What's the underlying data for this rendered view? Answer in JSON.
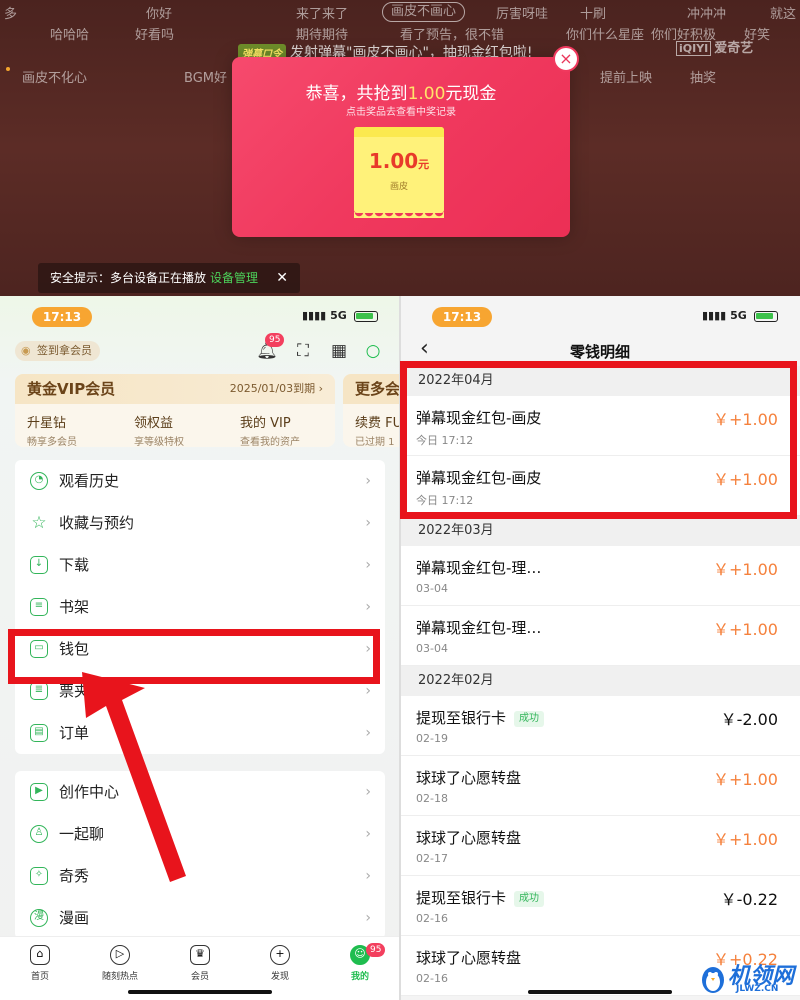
{
  "player": {
    "danmaku": [
      "多",
      "你好",
      "来了来了",
      "画皮不画心",
      "厉害呀哇",
      "十刷",
      "冲冲冲",
      "就这",
      "哈哈哈",
      "好看吗",
      "期待期待",
      "看了预告，很不错",
      "你们什么星座",
      "你们好积极",
      "好笑",
      "画皮不化心",
      "BGM好",
      "提前上映",
      "抽奖"
    ],
    "command_tag": "弹幕口令",
    "command_text": "发射弹幕\"画皮不画心\"，抽现金红包啦!",
    "brand": "爱奇艺",
    "brand_box": "iQIYI",
    "popup": {
      "title_prefix": "恭喜，共抢到",
      "title_amount": "1.00",
      "title_suffix": "元现金",
      "subtitle": "点击奖品去查看中奖记录",
      "ticket_value": "1.00",
      "ticket_unit": "元",
      "ticket_label": "画皮",
      "close": "×"
    },
    "safety": {
      "text": "安全提示：多台设备正在播放",
      "link": "设备管理",
      "close": "✕"
    }
  },
  "my_page": {
    "time": "17:13",
    "network": "5G",
    "sign_badge": "签到拿会员",
    "bell_badge": "95",
    "vip": {
      "title": "黄金VIP会员",
      "expiry": "2025/01/03到期 ›",
      "cols": [
        {
          "t": "升星钻",
          "s": "畅享多会员"
        },
        {
          "t": "领权益",
          "s": "享等级特权"
        },
        {
          "t": "我的 VIP",
          "s": "查看我的资产"
        }
      ]
    },
    "vip2": {
      "title": "更多会",
      "cols": [
        {
          "t": "续费 FU",
          "s": "已过期 1"
        }
      ]
    },
    "menu_group1": [
      "观看历史",
      "收藏与预约",
      "下载",
      "书架",
      "钱包",
      "票夹",
      "订单"
    ],
    "menu_group2": [
      "创作中心",
      "一起聊",
      "奇秀",
      "漫画"
    ],
    "tabs": [
      "首页",
      "随刻热点",
      "会员",
      "发现",
      "我的"
    ],
    "tab_badge": "95"
  },
  "detail_page": {
    "time": "17:13",
    "network": "5G",
    "title": "零钱明细",
    "sections": [
      {
        "month": "2022年04月",
        "rows": [
          {
            "name": "弹幕现金红包-画皮",
            "date": "今日 17:12",
            "amount": "￥+1.00",
            "status": ""
          },
          {
            "name": "弹幕现金红包-画皮",
            "date": "今日 17:12",
            "amount": "￥+1.00",
            "status": ""
          }
        ]
      },
      {
        "month": "2022年03月",
        "rows": [
          {
            "name": "弹幕现金红包-理…",
            "date": "03-04",
            "amount": "￥+1.00",
            "status": ""
          },
          {
            "name": "弹幕现金红包-理…",
            "date": "03-04",
            "amount": "￥+1.00",
            "status": ""
          }
        ]
      },
      {
        "month": "2022年02月",
        "rows": [
          {
            "name": "提现至银行卡",
            "date": "02-19",
            "amount": "￥-2.00",
            "status": "成功"
          },
          {
            "name": "球球了心愿转盘",
            "date": "02-18",
            "amount": "￥+1.00",
            "status": ""
          },
          {
            "name": "球球了心愿转盘",
            "date": "02-17",
            "amount": "￥+1.00",
            "status": ""
          },
          {
            "name": "提现至银行卡",
            "date": "02-16",
            "amount": "￥-0.22",
            "status": "成功"
          },
          {
            "name": "球球了心愿转盘",
            "date": "02-16",
            "amount": "￥+0.22",
            "status": ""
          }
        ]
      }
    ]
  },
  "watermark": {
    "name": "机领网",
    "domain": "JLWZ.CN"
  },
  "colors": {
    "accent_green": "#1fbd4f",
    "annotation_red": "#e8141c",
    "amount_orange": "#f5813c",
    "popup_pink": "#f0395e"
  }
}
